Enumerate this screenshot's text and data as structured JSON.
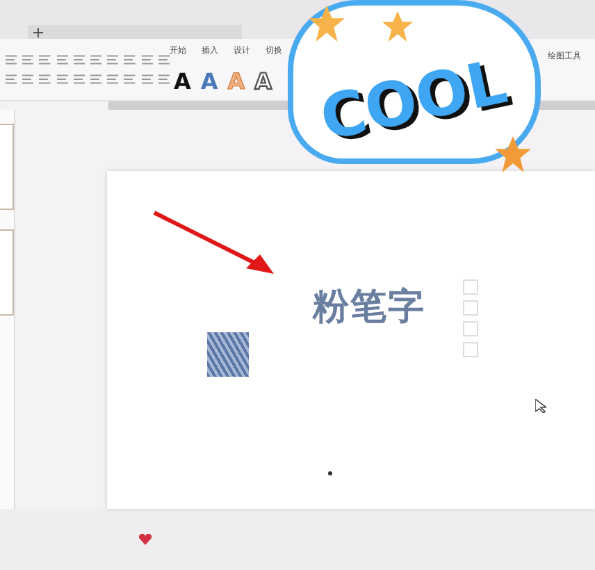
{
  "ribbon": {
    "tabs": [
      {
        "label": "开始"
      },
      {
        "label": "插入"
      },
      {
        "label": "设计"
      },
      {
        "label": "切换"
      }
    ],
    "right_tabs": [
      {
        "label": "绘图工具"
      }
    ],
    "style_gallery": [
      {
        "letter": "A",
        "kind": "black"
      },
      {
        "letter": "A",
        "kind": "blue"
      },
      {
        "letter": "A",
        "kind": "orange"
      },
      {
        "letter": "A",
        "kind": "outline"
      }
    ]
  },
  "slide": {
    "title": "粉笔字"
  },
  "sticker": {
    "text": "COOL"
  }
}
